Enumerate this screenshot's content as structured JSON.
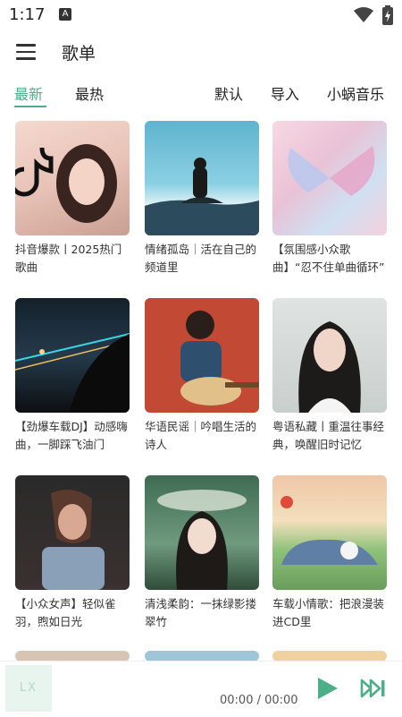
{
  "status": {
    "time": "1:17",
    "notif_icon": "a-icon",
    "wifi_icon": "wifi-icon",
    "battery_icon": "battery-charging-icon"
  },
  "appbar": {
    "title": "歌单",
    "menu_icon": "menu-icon"
  },
  "tabs": {
    "left": [
      {
        "label": "最新",
        "active": true
      },
      {
        "label": "最热",
        "active": false
      }
    ],
    "right": [
      {
        "label": "默认"
      },
      {
        "label": "导入"
      },
      {
        "label": "小蜗音乐"
      }
    ]
  },
  "playlists": [
    {
      "caption": "抖音爆款丨2025热门歌曲"
    },
    {
      "caption": "情绪孤岛｜活在自己的频道里"
    },
    {
      "caption": "【氛围感小众歌曲】“忍不住单曲循环”"
    },
    {
      "caption": "【劲爆车载DJ】动感嗨曲，一脚踩飞油门"
    },
    {
      "caption": "华语民谣｜吟唱生活的诗人"
    },
    {
      "caption": "粤语私藏丨重温往事经典，唤醒旧时记忆"
    },
    {
      "caption": "【小众女声】轻似雀羽，煦如日光"
    },
    {
      "caption": "清浅柔韵：一抹绿影搂翠竹"
    },
    {
      "caption": "车载小情歌：把浪漫装进CD里"
    }
  ],
  "player": {
    "art_text": "LX",
    "timecode": "00:00 / 00:00",
    "play_icon": "play-icon",
    "next_icon": "skip-next-icon"
  },
  "colors": {
    "accent": "#4caf88"
  }
}
